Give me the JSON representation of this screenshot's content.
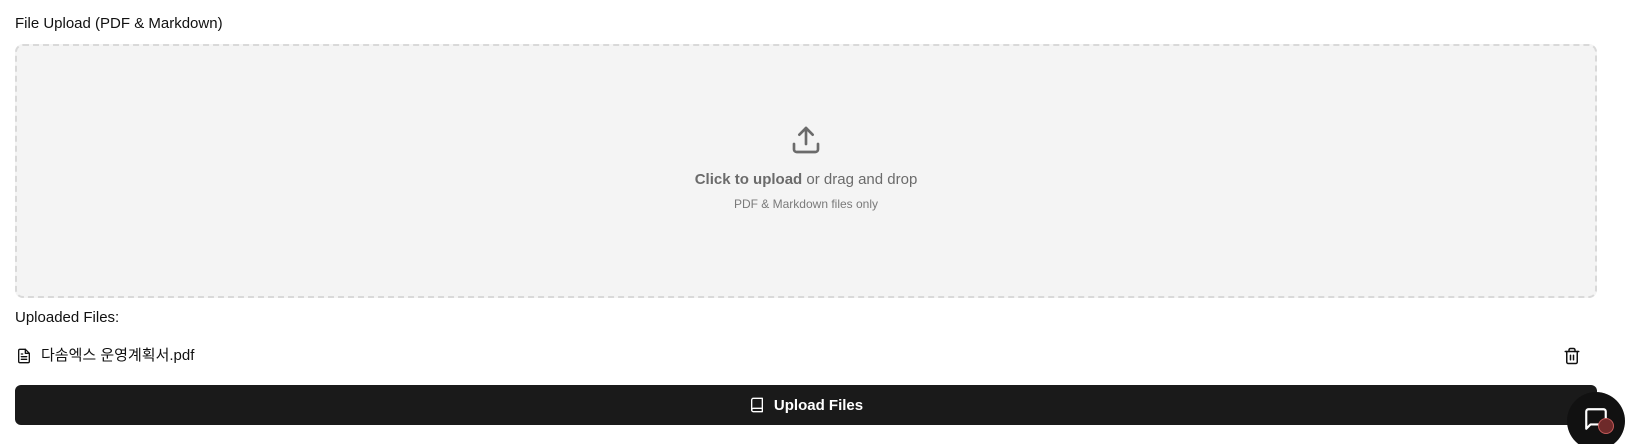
{
  "upload": {
    "section_label": "File Upload (PDF & Markdown)",
    "dropzone": {
      "primary_bold": "Click to upload",
      "primary_rest": " or drag and drop",
      "hint": "PDF & Markdown files only",
      "icon": "upload-icon"
    }
  },
  "uploaded": {
    "label": "Uploaded Files:",
    "files": [
      {
        "name": "다솜엑스 운영계획서.pdf",
        "icon": "file-text-icon",
        "action_icon": "trash-icon"
      }
    ]
  },
  "actions": {
    "upload_button_label": "Upload Files",
    "upload_button_icon": "book-icon"
  },
  "chat_widget": {
    "icon": "chat-icon"
  },
  "colors": {
    "button_bg": "#1a1a1a",
    "dropzone_bg": "#f4f4f4",
    "dropzone_border": "#d9d9d9",
    "muted_text": "#6b6b6b"
  }
}
